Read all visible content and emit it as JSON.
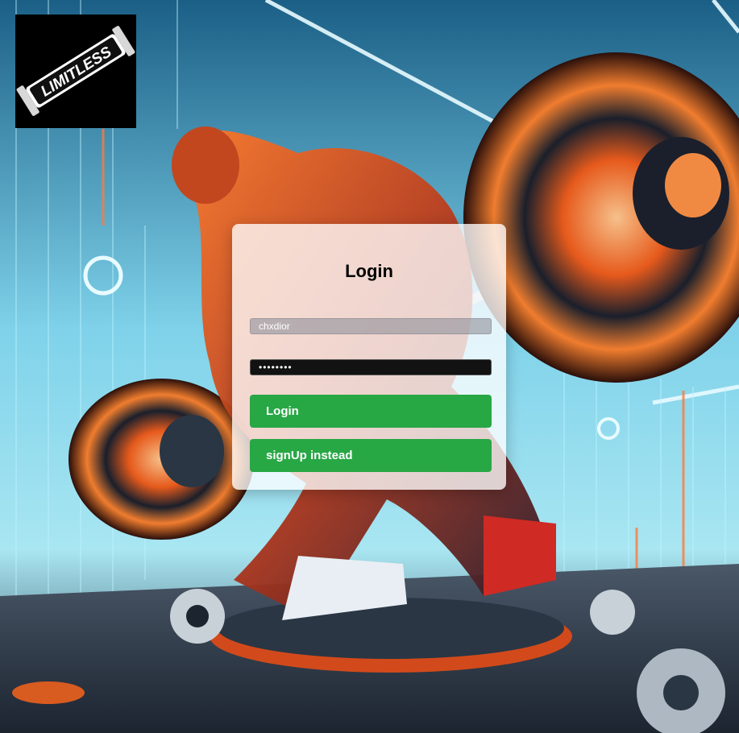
{
  "brand": {
    "logo_text": "LIMITLESS",
    "logo_icon": "dumbbell-icon"
  },
  "background": {
    "description_icon": "weightlifter-illustration",
    "accent_colors": [
      "#ff5a1f",
      "#3fd7f2",
      "#0f2a44"
    ]
  },
  "login_form": {
    "title": "Login",
    "username": {
      "value": "chxdior"
    },
    "password": {
      "value": "••••••••"
    },
    "login_button_label": "Login",
    "signup_button_label": "signUp instead",
    "button_color": "#28a745"
  }
}
